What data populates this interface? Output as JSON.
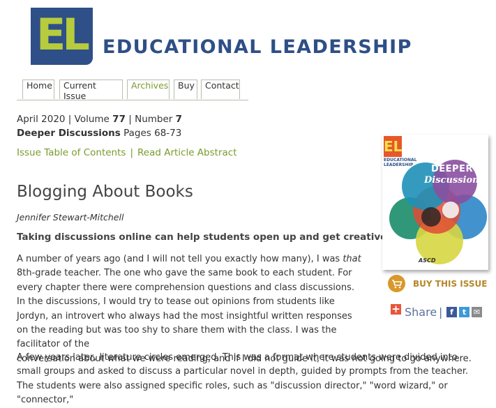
{
  "header": {
    "logo_text": "EL",
    "brand": "EDUCATIONAL LEADERSHIP",
    "colors": {
      "navy": "#2e4f87",
      "lime": "#b6cc3c"
    }
  },
  "nav": {
    "items": [
      {
        "label": "Home"
      },
      {
        "label": "Current Issue"
      },
      {
        "label": "Archives",
        "active": true
      },
      {
        "label": "Buy"
      },
      {
        "label": "Contact"
      }
    ]
  },
  "issue": {
    "date": "April 2020",
    "volume_label": "Volume",
    "volume": "77",
    "number_label": "Number",
    "number": "7",
    "theme": "Deeper Discussions",
    "pages": "Pages 68-73",
    "links": {
      "toc": "Issue Table of Contents",
      "abstract": "Read Article Abstract"
    }
  },
  "article": {
    "title": "Blogging About Books",
    "author": "Jennifer Stewart-Mitchell",
    "deck": "Taking discussions online can help students open up and get creative.",
    "p1_a": "A number of years ago (and I will not tell you exactly how many), I was ",
    "p1_em": "that",
    "p1_b": " 8th-grade teacher. The one who gave the same book to each student. For every chapter there were comprehension questions and class discussions. In the discussions, I would try to tease out opinions from students like Jordyn, an introvert who always had the most insightful written responses on the reading but was too shy to share them with the class. I was the facilitator of the",
    "p1_c": "conversation about what we were reading, and if I did not guide it, it was not going to go anywhere.",
    "p2": "A few years later, literature circles emerged. This was a format where students were divided into small groups and asked to discuss a particular novel in depth, guided by prompts from the teacher. The students were also assigned specific roles, such as \"discussion director,\" \"word wizard,\" or \"connector,\""
  },
  "sidebar": {
    "cover": {
      "badge": "EL",
      "masthead": "EDUCATIONAL\nLEADERSHIP",
      "title": "DEEPER",
      "subtitle": "Discussions",
      "publisher": "ASCD"
    },
    "buy_label": "BUY THIS ISSUE",
    "share_label": "Share",
    "share_sep": "|",
    "social": {
      "facebook": "f",
      "twitter": "t",
      "email": "✉"
    },
    "icons": [
      "cart-icon",
      "plus-icon",
      "facebook-icon",
      "twitter-icon",
      "email-icon"
    ],
    "colors": {
      "buy": "#d9982a",
      "share": "#5b7399"
    }
  }
}
